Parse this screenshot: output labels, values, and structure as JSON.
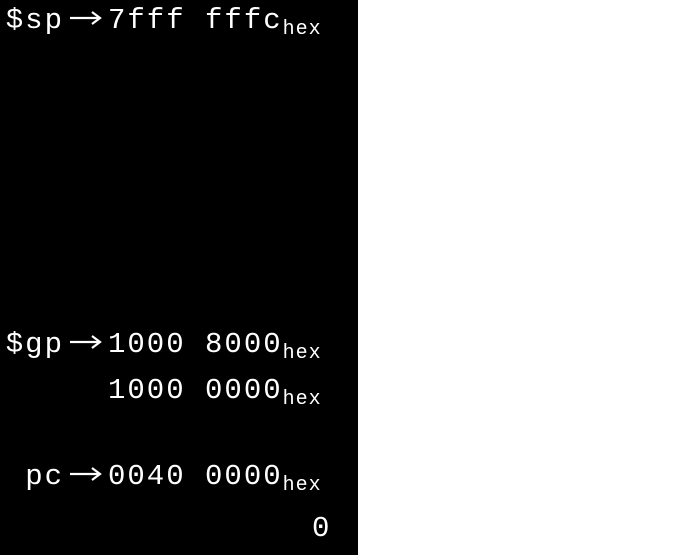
{
  "sp": {
    "label": "$sp",
    "addr": "7fff fffc",
    "suffix": "hex"
  },
  "gp": {
    "label": "$gp",
    "addr": "1000 8000",
    "suffix": "hex"
  },
  "gp_line2": {
    "addr": "1000 0000",
    "suffix": "hex"
  },
  "pc": {
    "label": "pc",
    "addr": "0040 0000",
    "suffix": "hex"
  },
  "zero": {
    "value": "0"
  }
}
